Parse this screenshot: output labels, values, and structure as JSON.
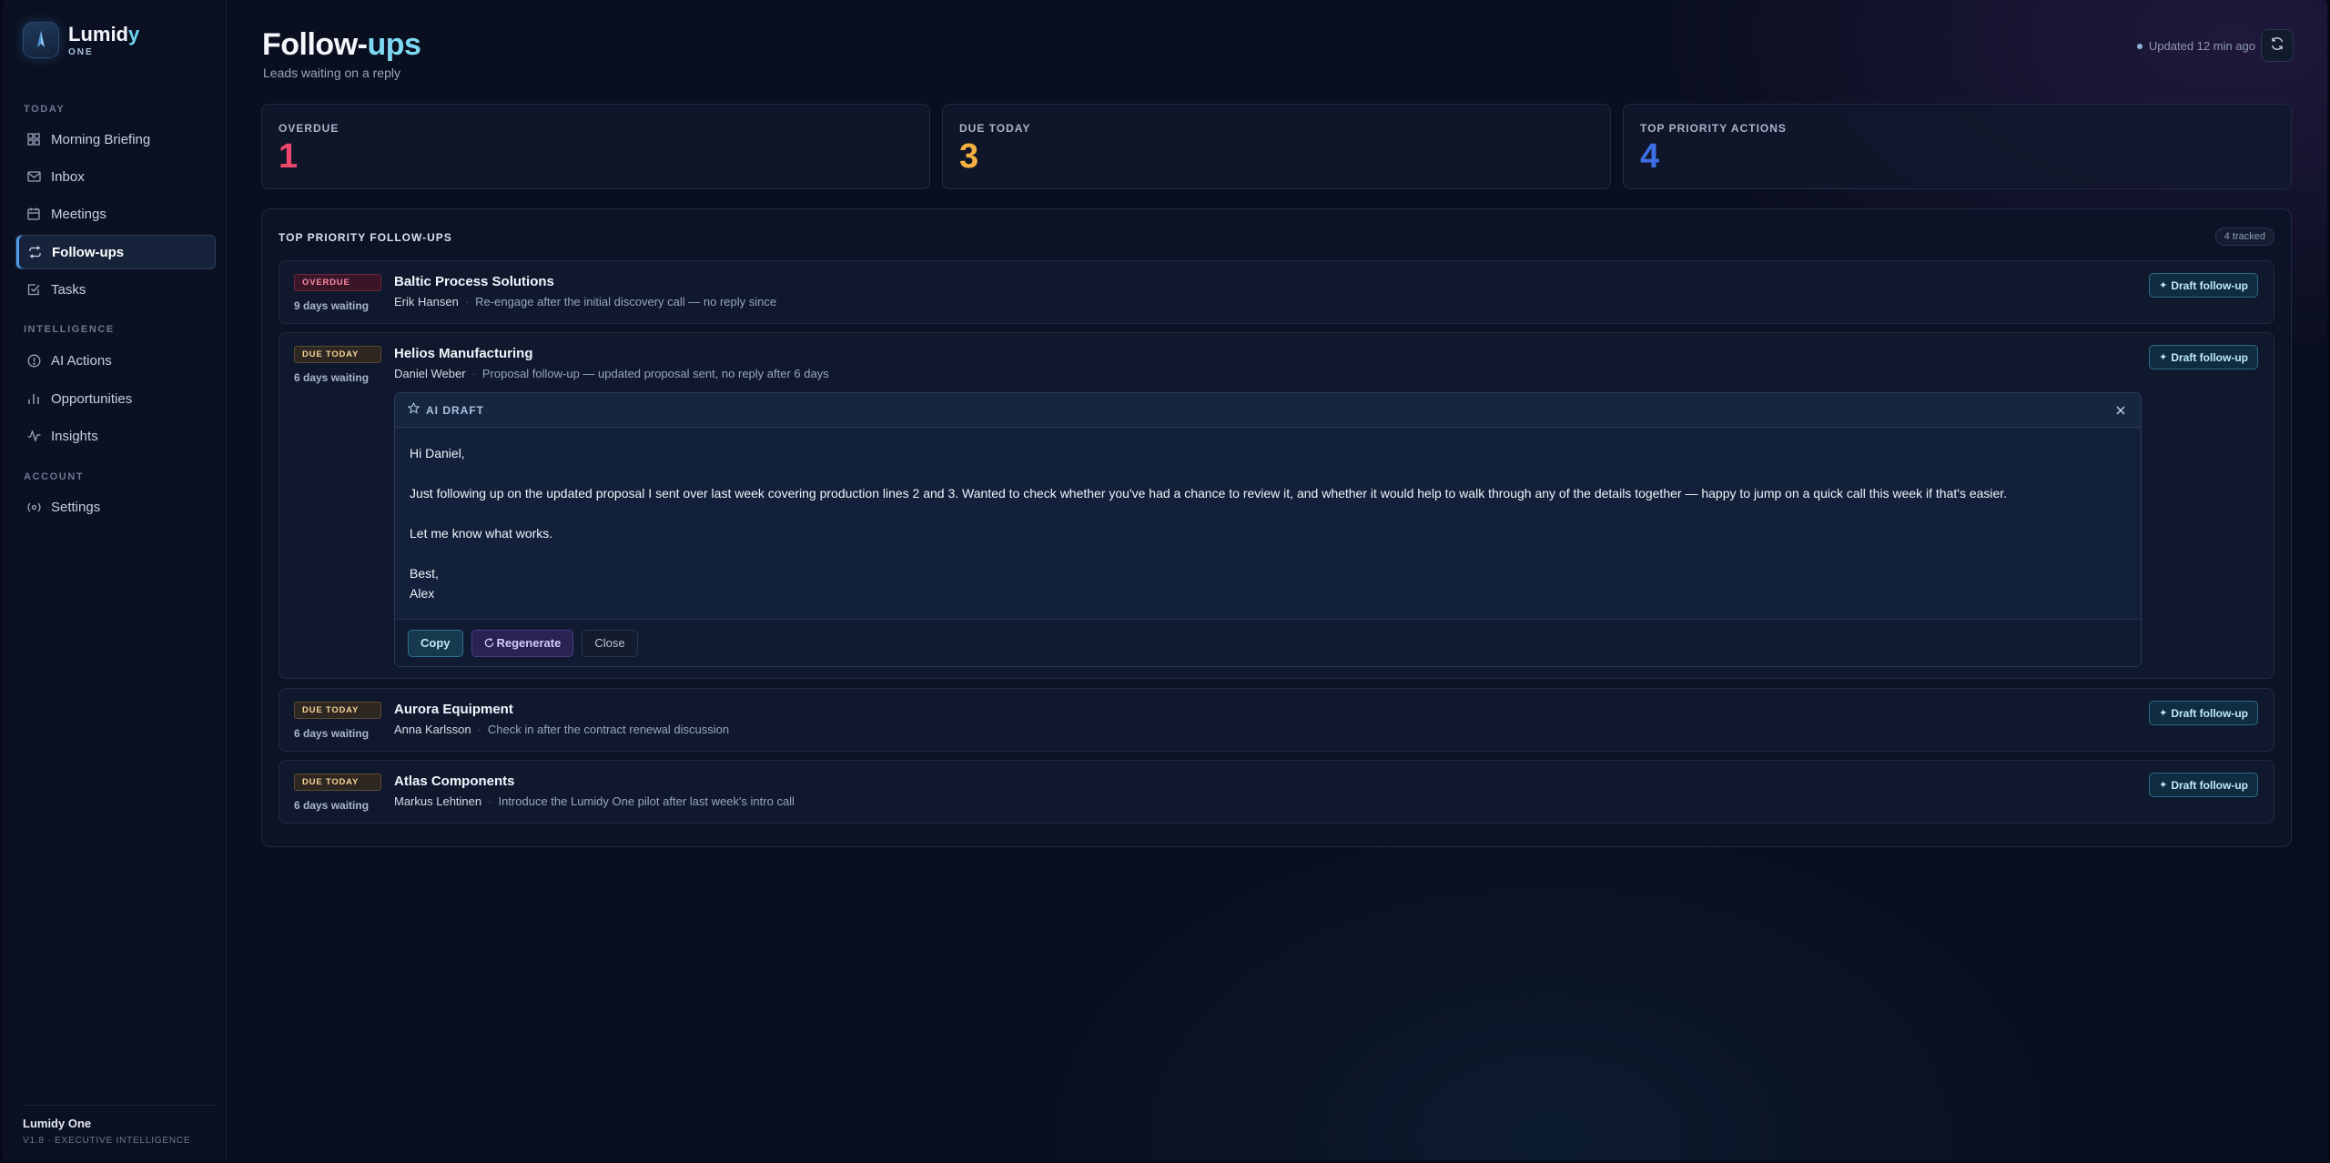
{
  "brand": {
    "name_part1": "Lumid",
    "name_part2": "y",
    "sub": "ONE"
  },
  "sidebar": {
    "sections": [
      {
        "label": "TODAY"
      },
      {
        "label": "INTELLIGENCE"
      },
      {
        "label": "ACCOUNT"
      }
    ],
    "items": [
      {
        "label": "Morning Briefing",
        "icon": "grid-icon"
      },
      {
        "label": "Inbox",
        "icon": "mail-icon"
      },
      {
        "label": "Meetings",
        "icon": "calendar-icon"
      },
      {
        "label": "Follow-ups",
        "icon": "repeat-icon",
        "active": true
      },
      {
        "label": "Tasks",
        "icon": "checkbox-icon"
      },
      {
        "label": "AI Actions",
        "icon": "info-circle-icon"
      },
      {
        "label": "Opportunities",
        "icon": "bar-chart-icon"
      },
      {
        "label": "Insights",
        "icon": "activity-icon"
      },
      {
        "label": "Settings",
        "icon": "settings-icon"
      }
    ],
    "footer": {
      "title": "Lumidy One",
      "version": "V1.8 · EXECUTIVE INTELLIGENCE"
    }
  },
  "header": {
    "title_part1": "Follow-",
    "title_part2": "ups",
    "subtitle": "Leads waiting on a reply",
    "updated": "Updated 12 min ago"
  },
  "stats": [
    {
      "label": "OVERDUE",
      "value": "1",
      "color": "#f0476e"
    },
    {
      "label": "DUE TODAY",
      "value": "3",
      "color": "#f5b041"
    },
    {
      "label": "TOP PRIORITY ACTIONS",
      "value": "4",
      "color": "#3f6fe6"
    }
  ],
  "panel": {
    "title": "TOP PRIORITY FOLLOW-UPS",
    "badge": "4 tracked",
    "draft_label": "Draft follow-up",
    "rows": [
      {
        "tag": "OVERDUE",
        "waiting": "9 days waiting",
        "company": "Baltic Process Solutions",
        "contact": "Erik Hansen",
        "note": "Re-engage after the initial discovery call — no reply since"
      },
      {
        "tag": "DUE TODAY",
        "waiting": "6 days waiting",
        "company": "Helios Manufacturing",
        "contact": "Daniel Weber",
        "note": "Proposal follow-up — updated proposal sent, no reply after 6 days"
      },
      {
        "tag": "DUE TODAY",
        "waiting": "6 days waiting",
        "company": "Aurora Equipment",
        "contact": "Anna Karlsson",
        "note": "Check in after the contract renewal discussion"
      },
      {
        "tag": "DUE TODAY",
        "waiting": "6 days waiting",
        "company": "Atlas Components",
        "contact": "Markus Lehtinen",
        "note": "Introduce the Lumidy One pilot after last week's intro call"
      }
    ]
  },
  "ai_draft": {
    "label": "AI DRAFT",
    "greeting": "Hi Daniel,",
    "body": "Just following up on the updated proposal I sent over last week covering production lines 2 and 3. Wanted to check whether you've had a chance to review it, and whether it would help to walk through any of the details together — happy to jump on a quick call this week if that's easier.",
    "closing_line": "Let me know what works.",
    "signoff": "Best,",
    "signature": "Alex",
    "copy_label": "Copy",
    "regenerate_label": "Regenerate",
    "close_label": "Close"
  }
}
